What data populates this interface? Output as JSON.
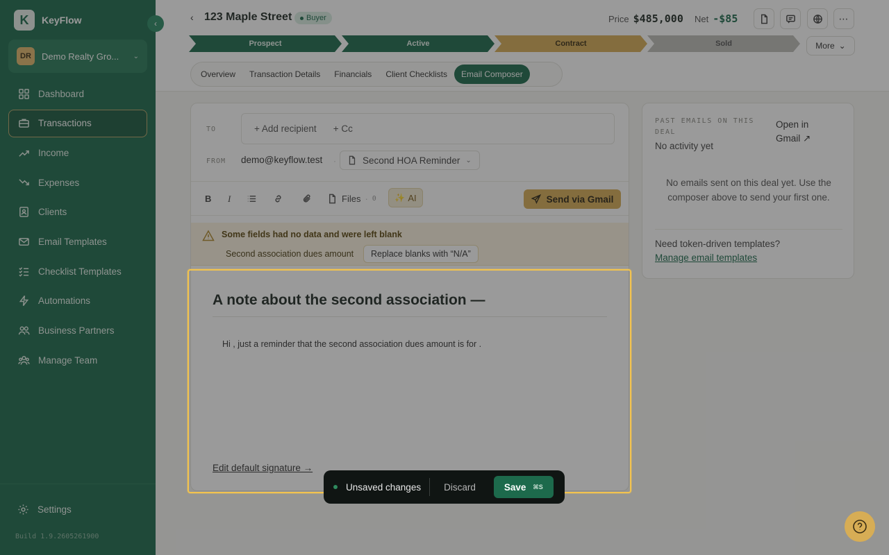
{
  "brand": {
    "name": "KeyFlow",
    "logo_letter": "K"
  },
  "org": {
    "initials": "DR",
    "name": "Demo Realty Gro..."
  },
  "sidebar": {
    "items": [
      {
        "label": "Dashboard",
        "icon": "grid-icon"
      },
      {
        "label": "Transactions",
        "icon": "briefcase-icon",
        "active": true
      },
      {
        "label": "Income",
        "icon": "trend-up-icon"
      },
      {
        "label": "Expenses",
        "icon": "trend-down-icon"
      },
      {
        "label": "Clients",
        "icon": "contact-card-icon"
      },
      {
        "label": "Email Templates",
        "icon": "envelope-icon"
      },
      {
        "label": "Checklist Templates",
        "icon": "checklist-icon"
      },
      {
        "label": "Automations",
        "icon": "lightning-icon"
      },
      {
        "label": "Business Partners",
        "icon": "handshake-icon"
      },
      {
        "label": "Manage Team",
        "icon": "team-icon"
      }
    ],
    "settings": "Settings",
    "build": "Build 1.9.2605261900"
  },
  "header": {
    "back_icon": "chevron-left-icon",
    "title": "123 Maple Street",
    "badge": "Buyer",
    "price_label": "Price",
    "price_value": "$485,000",
    "net_label": "Net",
    "net_value": "-$85",
    "more_label": "More"
  },
  "stages": [
    {
      "label": "Prospect",
      "state": "done"
    },
    {
      "label": "Active",
      "state": "done"
    },
    {
      "label": "Contract",
      "state": "current"
    },
    {
      "label": "Sold",
      "state": "upcoming"
    }
  ],
  "tabs": [
    "Overview",
    "Transaction Details",
    "Financials",
    "Client Checklists",
    "Email Composer"
  ],
  "active_tab": "Email Composer",
  "composer": {
    "to_label": "TO",
    "add_recipient": "+ Add recipient",
    "add_cc": "+ Cc",
    "from_label": "FROM",
    "from_value": "demo@keyflow.test",
    "template_name": "Second HOA Reminder",
    "files_label": "Files",
    "files_count": "0",
    "ai_label": "AI",
    "send_label": "Send via Gmail",
    "warning_title": "Some fields had no data and were left blank",
    "missing_field": "Second association dues amount",
    "replace_label": "Replace blanks with “N/A”",
    "subject": "A note about the second association —",
    "body": "Hi , just a reminder that the second association dues amount is for .",
    "signature_link": "Edit default signature →"
  },
  "past_emails": {
    "label": "PAST EMAILS ON THIS DEAL",
    "status": "No activity yet",
    "open_gmail": "Open in Gmail ↗",
    "empty_message": "No emails sent on this deal yet. Use the composer above to send your first one.",
    "question": "Need token-driven templates?",
    "manage_link": "Manage email templates"
  },
  "savebar": {
    "status": "Unsaved changes",
    "discard": "Discard",
    "save": "Save",
    "shortcut": "⌘S"
  },
  "colors": {
    "sidebar": "#1d6a4c",
    "accent_gold": "#d7ad55",
    "stage_done": "#1d6a4c",
    "stage_current": "#d7ad55",
    "stage_upcoming": "#bdbdb8"
  }
}
